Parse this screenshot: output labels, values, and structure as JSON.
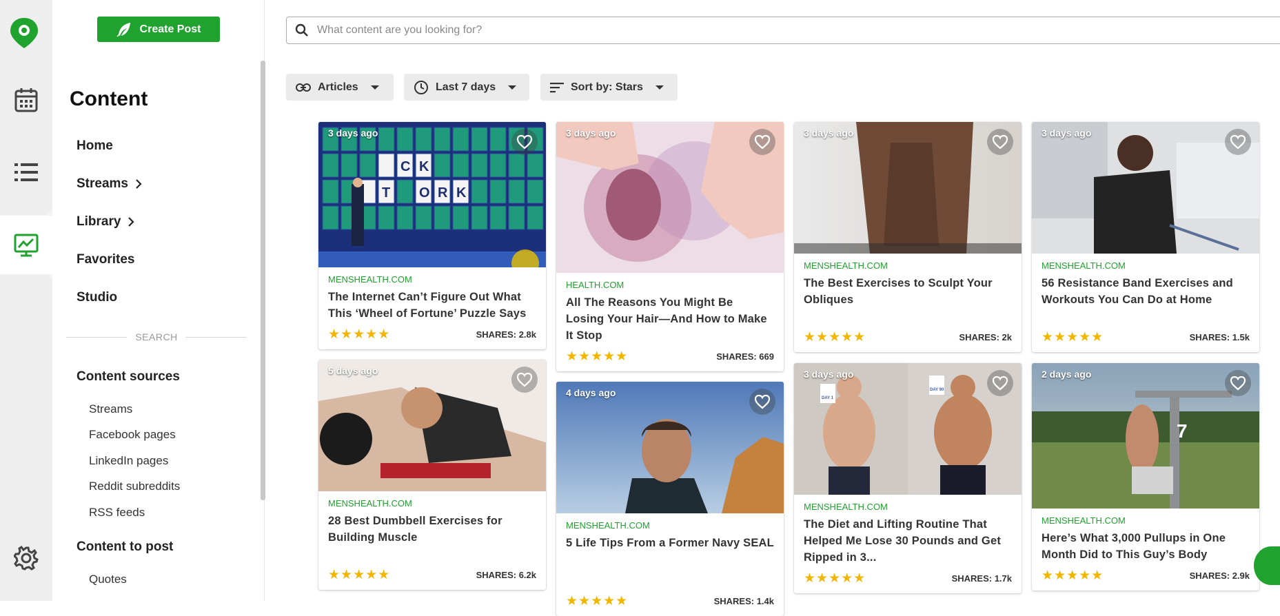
{
  "sidebar": {
    "create_post": "Create Post",
    "title": "Content",
    "nav": [
      {
        "label": "Home"
      },
      {
        "label": "Streams"
      },
      {
        "label": "Library"
      },
      {
        "label": "Favorites"
      },
      {
        "label": "Studio"
      }
    ],
    "search_divider": "SEARCH",
    "content_sources": {
      "heading": "Content sources",
      "items": [
        "Streams",
        "Facebook pages",
        "LinkedIn pages",
        "Reddit subreddits",
        "RSS feeds"
      ]
    },
    "content_to_post": {
      "heading": "Content to post",
      "items": [
        "Quotes"
      ]
    }
  },
  "search": {
    "placeholder": "What content are you looking for?"
  },
  "filters": {
    "type": "Articles",
    "range": "Last 7 days",
    "sort": "Sort by: Stars"
  },
  "colors": {
    "accent": "#1fa22e",
    "star": "#f2b600"
  },
  "cards": [
    {
      "age": "3 days ago",
      "source": "MENSHEALTH.COM",
      "title": "The Internet Can’t Figure Out What This ‘Wheel of Fortune’ Puzzle Says",
      "stars": "★★★★★",
      "shares": "SHARES: 2.8k"
    },
    {
      "age": "3 days ago",
      "source": "HEALTH.COM",
      "title": "All The Reasons You Might Be Losing Your Hair—And How to Make It Stop",
      "stars": "★★★★★",
      "shares": "SHARES: 669"
    },
    {
      "age": "3 days ago",
      "source": "MENSHEALTH.COM",
      "title": "The Best Exercises to Sculpt Your Obliques",
      "stars": "★★★★★",
      "shares": "SHARES: 2k"
    },
    {
      "age": "3 days ago",
      "source": "MENSHEALTH.COM",
      "title": "56 Resistance Band Exercises and Workouts You Can Do at Home",
      "stars": "★★★★★",
      "shares": "SHARES: 1.5k"
    },
    {
      "age": "5 days ago",
      "source": "MENSHEALTH.COM",
      "title": "28 Best Dumbbell Exercises for Building Muscle",
      "stars": "★★★★★",
      "shares": "SHARES: 6.2k"
    },
    {
      "age": "4 days ago",
      "source": "MENSHEALTH.COM",
      "title": "5 Life Tips From a Former Navy SEAL",
      "stars": "★★★★★",
      "shares": "SHARES: 1.4k"
    },
    {
      "age": "3 days ago",
      "source": "MENSHEALTH.COM",
      "title": "The Diet and Lifting Routine That Helped Me Lose 30 Pounds and Get Ripped in 3...",
      "stars": "★★★★★",
      "shares": "SHARES: 1.7k"
    },
    {
      "age": "2 days ago",
      "source": "MENSHEALTH.COM",
      "title": "Here’s What 3,000 Pullups in One Month Did to This Guy’s Body",
      "stars": "★★★★★",
      "shares": "SHARES: 2.9k"
    }
  ],
  "card_images": {
    "wof_letters": [
      "C",
      "K",
      "T",
      "O",
      "R",
      "K"
    ],
    "before_after_labels": [
      "DAY 1",
      "DAY 90"
    ],
    "pullup_number": "7"
  }
}
